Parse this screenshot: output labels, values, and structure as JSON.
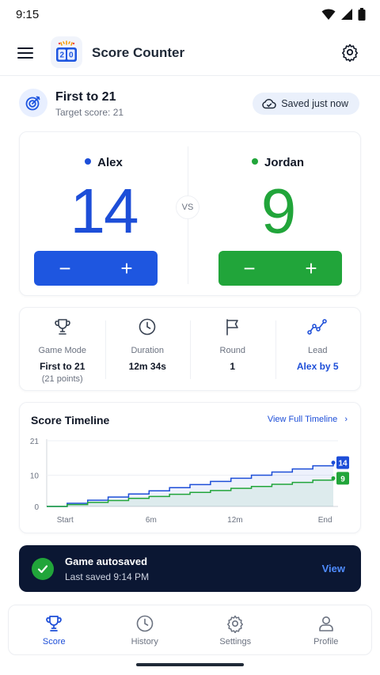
{
  "status_bar": {
    "time": "9:15"
  },
  "app_bar": {
    "title": "Score Counter",
    "logo_digits": [
      "2",
      "0"
    ]
  },
  "game": {
    "title": "First to 21",
    "subtitle": "Target score: 21",
    "saved_label": "Saved just now"
  },
  "players": [
    {
      "name": "Alex",
      "score": "14",
      "color": "#1d4ed8",
      "button_color": "#1e56e0"
    },
    {
      "name": "Jordan",
      "score": "9",
      "color": "#21a53a",
      "button_color": "#21a53a"
    }
  ],
  "controls": {
    "minus": "−",
    "plus": "+",
    "vs": "VS"
  },
  "stats": [
    {
      "icon": "trophy-icon",
      "label": "Game Mode",
      "value": "First to 21",
      "sub": "(21 points)"
    },
    {
      "icon": "clock-icon",
      "label": "Duration",
      "value": "12m 34s"
    },
    {
      "icon": "flag-icon",
      "label": "Round",
      "value": "1"
    },
    {
      "icon": "trend-icon",
      "label": "Lead",
      "value": "Alex by 5"
    }
  ],
  "timeline": {
    "title": "Score Timeline",
    "link_label": "View Full Timeline",
    "chart_data": {
      "type": "line",
      "x": [
        0,
        1,
        2,
        3,
        4,
        5,
        6,
        7,
        8,
        9,
        10,
        11,
        12,
        13,
        14
      ],
      "xticks": [
        "Start",
        "6m",
        "12m",
        "End"
      ],
      "yticks": [
        "0",
        "10",
        "21"
      ],
      "ylim": [
        0,
        21
      ],
      "series": [
        {
          "values": [
            0,
            1,
            2,
            3,
            4,
            5,
            6,
            7,
            8,
            9,
            10,
            11,
            12,
            13,
            14
          ],
          "end_label": "14",
          "color": "#1d4ed8"
        },
        {
          "values": [
            0,
            0.6,
            1.3,
            1.9,
            2.6,
            3.2,
            3.9,
            4.5,
            5.1,
            5.8,
            6.4,
            7.1,
            7.7,
            8.4,
            9
          ],
          "end_label": "9",
          "color": "#21a53a"
        }
      ]
    }
  },
  "toast": {
    "title": "Game autosaved",
    "subtitle": "Last saved 9:14 PM",
    "action": "View"
  },
  "nav": [
    {
      "icon": "trophy-icon",
      "label": "Score",
      "active": true
    },
    {
      "icon": "history-icon",
      "label": "History",
      "active": false
    },
    {
      "icon": "gear-icon",
      "label": "Settings",
      "active": false
    },
    {
      "icon": "profile-icon",
      "label": "Profile",
      "active": false
    }
  ]
}
